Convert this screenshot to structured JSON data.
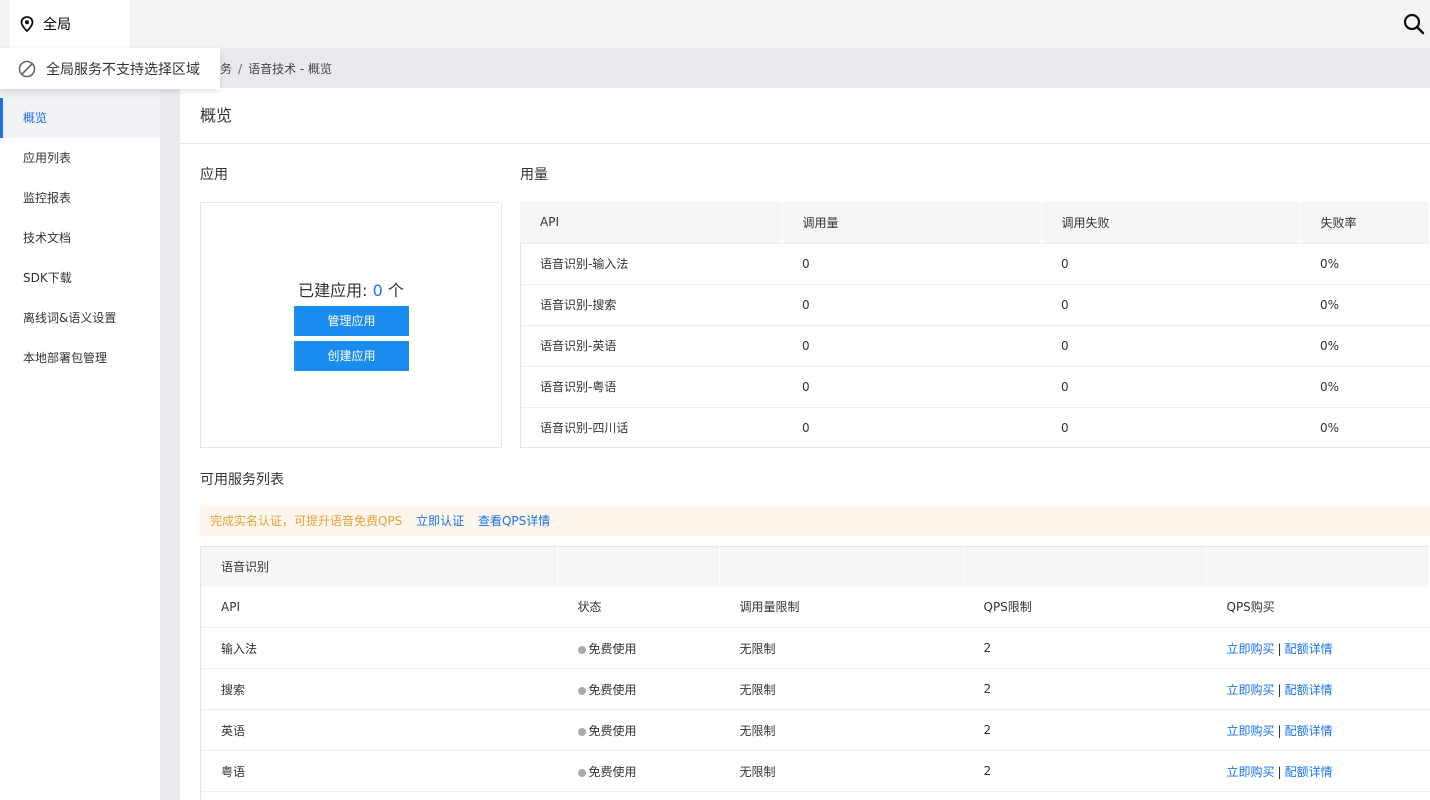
{
  "topbar": {
    "region_label": "全局",
    "region_dropdown_note": "全局服务不支持选择区域"
  },
  "breadcrumb": {
    "partial": "务",
    "current": "语音技术 - 概览"
  },
  "sidebar": {
    "items": [
      {
        "label": "概览",
        "active": true
      },
      {
        "label": "应用列表"
      },
      {
        "label": "监控报表"
      },
      {
        "label": "技术文档"
      },
      {
        "label": "SDK下载"
      },
      {
        "label": "离线词&语义设置"
      },
      {
        "label": "本地部署包管理"
      }
    ]
  },
  "main": {
    "title": "概览",
    "apps": {
      "section_label": "应用",
      "count_label": "已建应用:",
      "count_value": "0",
      "count_unit": "个",
      "manage_button": "管理应用",
      "create_button": "创建应用"
    },
    "usage": {
      "section_label": "用量",
      "columns": [
        "API",
        "调用量",
        "调用失败",
        "失败率"
      ],
      "rows": [
        [
          "语音识别-输入法",
          "0",
          "0",
          "0%"
        ],
        [
          "语音识别-搜索",
          "0",
          "0",
          "0%"
        ],
        [
          "语音识别-英语",
          "0",
          "0",
          "0%"
        ],
        [
          "语音识别-粤语",
          "0",
          "0",
          "0%"
        ],
        [
          "语音识别-四川话",
          "0",
          "0",
          "0%"
        ]
      ]
    },
    "services": {
      "section_label": "可用服务列表",
      "notice_text": "完成实名认证，可提升语音免费QPS",
      "notice_link_verify": "立即认证",
      "notice_link_qps": "查看QPS详情",
      "group_label": "语音识别",
      "columns": [
        "API",
        "状态",
        "调用量限制",
        "QPS限制",
        "QPS购买"
      ],
      "rows": [
        {
          "api": "输入法",
          "status": "免费使用",
          "limit": "无限制",
          "qps": "2",
          "buy": "立即购买",
          "detail": "配额详情"
        },
        {
          "api": "搜索",
          "status": "免费使用",
          "limit": "无限制",
          "qps": "2",
          "buy": "立即购买",
          "detail": "配额详情"
        },
        {
          "api": "英语",
          "status": "免费使用",
          "limit": "无限制",
          "qps": "2",
          "buy": "立即购买",
          "detail": "配额详情"
        },
        {
          "api": "粤语",
          "status": "免费使用",
          "limit": "无限制",
          "qps": "2",
          "buy": "立即购买",
          "detail": "配额详情"
        }
      ],
      "separator": "|"
    }
  },
  "colors": {
    "accent": "#1a73e8",
    "button": "#1a8cf0",
    "warning": "#e6a23c"
  }
}
